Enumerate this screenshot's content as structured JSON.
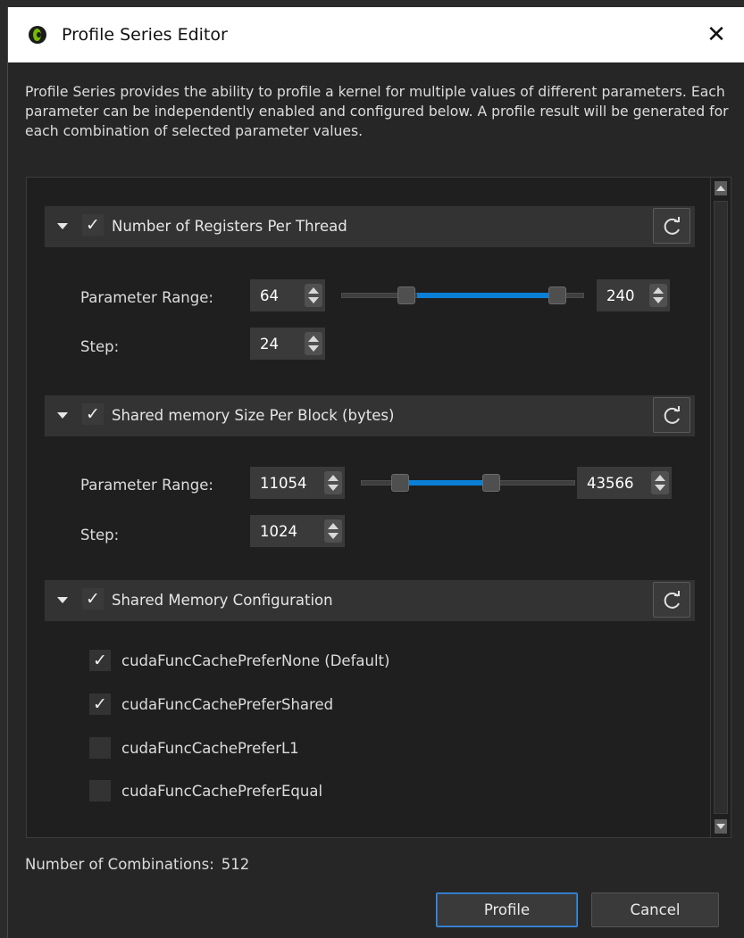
{
  "window": {
    "title": "Profile Series Editor",
    "close_glyph": "✕"
  },
  "description": "Profile Series provides the ability to profile a kernel for multiple values of different parameters. Each parameter can be independently enabled and configured below. A profile result will be generated for each combination of selected parameter values.",
  "sections": {
    "registers": {
      "title": "Number of Registers Per Thread",
      "enabled": true,
      "range_label": "Parameter Range:",
      "min_value": "64",
      "max_value": "240",
      "step_label": "Step:",
      "step_value": "24"
    },
    "shared_size": {
      "title": "Shared memory Size Per Block (bytes)",
      "enabled": true,
      "range_label": "Parameter Range:",
      "min_value": "11054",
      "max_value": "43566",
      "step_label": "Step:",
      "step_value": "1024"
    },
    "shared_config": {
      "title": "Shared Memory Configuration",
      "enabled": true,
      "options": [
        {
          "label": "cudaFuncCachePreferNone (Default)",
          "checked": true
        },
        {
          "label": "cudaFuncCachePreferShared",
          "checked": true
        },
        {
          "label": "cudaFuncCachePreferL1",
          "checked": false
        },
        {
          "label": "cudaFuncCachePreferEqual",
          "checked": false
        }
      ]
    }
  },
  "check_glyph": "✓",
  "footer": {
    "combinations_label": "Number of Combinations:",
    "combinations_value": "512",
    "profile_label": "Profile",
    "cancel_label": "Cancel"
  },
  "colors": {
    "accent": "#0a7fd6",
    "background": "#262626",
    "panel": "#1f1f1f",
    "header": "#333333"
  },
  "icons": [
    "app-logo-icon",
    "close-icon",
    "expand-arrow-icon",
    "refresh-icon",
    "spin-arrows-icon",
    "scroll-up-icon",
    "scroll-down-icon"
  ]
}
